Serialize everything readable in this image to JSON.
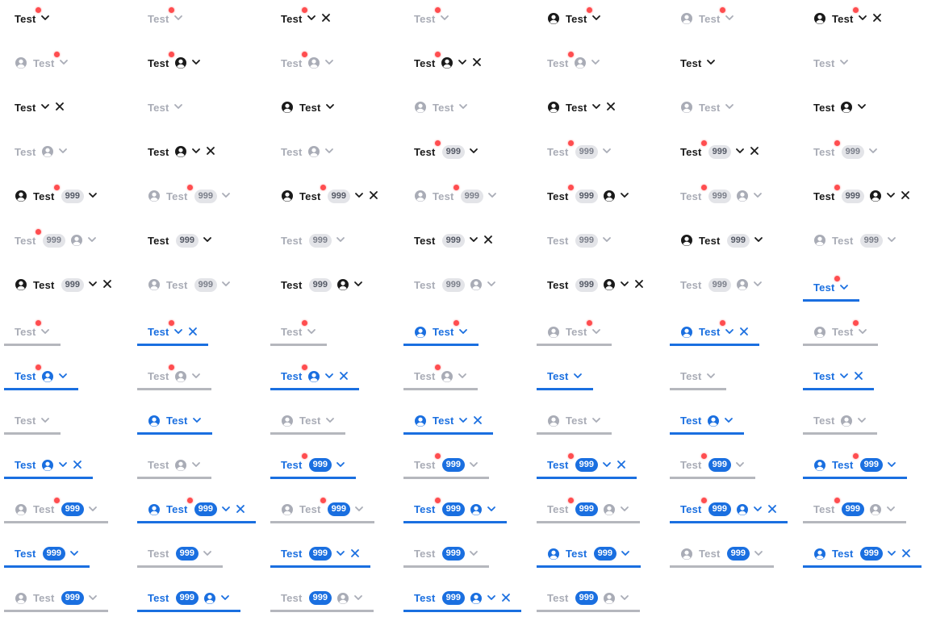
{
  "page": {
    "background": "#ffffff"
  },
  "colors": {
    "dark_text": "#1a1a1a",
    "muted_text": "#a9acb6",
    "accent_blue": "#1a6fe0",
    "notification_dot": "#ff4d4f",
    "underline_muted": "#b5b7bd",
    "badge_gray": "#e3e4e8"
  },
  "icons": {
    "avatar": "user-circle-icon",
    "chevron": "chevron-down-icon",
    "close": "close-icon",
    "dot": "notification-dot"
  },
  "tabs": [
    {
      "label": "Test",
      "theme": "dark",
      "dot": true,
      "lead_avatar": false,
      "badge": "",
      "trail_avatar": false,
      "close": false
    },
    {
      "label": "Test",
      "theme": "muted",
      "dot": true,
      "lead_avatar": false,
      "badge": "",
      "trail_avatar": false,
      "close": false
    },
    {
      "label": "Test",
      "theme": "dark",
      "dot": true,
      "lead_avatar": false,
      "badge": "",
      "trail_avatar": false,
      "close": true
    },
    {
      "label": "Test",
      "theme": "muted",
      "dot": true,
      "lead_avatar": false,
      "badge": "",
      "trail_avatar": false,
      "close": false
    },
    {
      "label": "Test",
      "theme": "dark",
      "dot": true,
      "lead_avatar": true,
      "badge": "",
      "trail_avatar": false,
      "close": false
    },
    {
      "label": "Test",
      "theme": "muted",
      "dot": true,
      "lead_avatar": true,
      "badge": "",
      "trail_avatar": false,
      "close": false
    },
    {
      "label": "Test",
      "theme": "dark",
      "dot": true,
      "lead_avatar": true,
      "badge": "",
      "trail_avatar": false,
      "close": true
    },
    {
      "label": "Test",
      "theme": "muted",
      "dot": true,
      "lead_avatar": true,
      "badge": "",
      "trail_avatar": false,
      "close": false
    },
    {
      "label": "Test",
      "theme": "dark",
      "dot": true,
      "lead_avatar": false,
      "badge": "",
      "trail_avatar": true,
      "close": false
    },
    {
      "label": "Test",
      "theme": "muted",
      "dot": true,
      "lead_avatar": false,
      "badge": "",
      "trail_avatar": true,
      "close": false
    },
    {
      "label": "Test",
      "theme": "dark",
      "dot": true,
      "lead_avatar": false,
      "badge": "",
      "trail_avatar": true,
      "close": true
    },
    {
      "label": "Test",
      "theme": "muted",
      "dot": true,
      "lead_avatar": false,
      "badge": "",
      "trail_avatar": true,
      "close": false
    },
    {
      "label": "Test",
      "theme": "dark",
      "dot": false,
      "lead_avatar": false,
      "badge": "",
      "trail_avatar": false,
      "close": false
    },
    {
      "label": "Test",
      "theme": "muted",
      "dot": false,
      "lead_avatar": false,
      "badge": "",
      "trail_avatar": false,
      "close": false
    },
    {
      "label": "Test",
      "theme": "dark",
      "dot": false,
      "lead_avatar": false,
      "badge": "",
      "trail_avatar": false,
      "close": true
    },
    {
      "label": "Test",
      "theme": "muted",
      "dot": false,
      "lead_avatar": false,
      "badge": "",
      "trail_avatar": false,
      "close": false
    },
    {
      "label": "Test",
      "theme": "dark",
      "dot": false,
      "lead_avatar": true,
      "badge": "",
      "trail_avatar": false,
      "close": false
    },
    {
      "label": "Test",
      "theme": "muted",
      "dot": false,
      "lead_avatar": true,
      "badge": "",
      "trail_avatar": false,
      "close": false
    },
    {
      "label": "Test",
      "theme": "dark",
      "dot": false,
      "lead_avatar": true,
      "badge": "",
      "trail_avatar": false,
      "close": true
    },
    {
      "label": "Test",
      "theme": "muted",
      "dot": false,
      "lead_avatar": true,
      "badge": "",
      "trail_avatar": false,
      "close": false
    },
    {
      "label": "Test",
      "theme": "dark",
      "dot": false,
      "lead_avatar": false,
      "badge": "",
      "trail_avatar": true,
      "close": false
    },
    {
      "label": "Test",
      "theme": "muted",
      "dot": false,
      "lead_avatar": false,
      "badge": "",
      "trail_avatar": true,
      "close": false
    },
    {
      "label": "Test",
      "theme": "dark",
      "dot": false,
      "lead_avatar": false,
      "badge": "",
      "trail_avatar": true,
      "close": true
    },
    {
      "label": "Test",
      "theme": "muted",
      "dot": false,
      "lead_avatar": false,
      "badge": "",
      "trail_avatar": true,
      "close": false
    },
    {
      "label": "Test",
      "theme": "dark",
      "dot": true,
      "lead_avatar": false,
      "badge": "999",
      "trail_avatar": false,
      "close": false
    },
    {
      "label": "Test",
      "theme": "muted",
      "dot": true,
      "lead_avatar": false,
      "badge": "999",
      "trail_avatar": false,
      "close": false
    },
    {
      "label": "Test",
      "theme": "dark",
      "dot": true,
      "lead_avatar": false,
      "badge": "999",
      "trail_avatar": false,
      "close": true
    },
    {
      "label": "Test",
      "theme": "muted",
      "dot": true,
      "lead_avatar": false,
      "badge": "999",
      "trail_avatar": false,
      "close": false
    },
    {
      "label": "Test",
      "theme": "dark",
      "dot": true,
      "lead_avatar": true,
      "badge": "999",
      "trail_avatar": false,
      "close": false
    },
    {
      "label": "Test",
      "theme": "muted",
      "dot": true,
      "lead_avatar": true,
      "badge": "999",
      "trail_avatar": false,
      "close": false
    },
    {
      "label": "Test",
      "theme": "dark",
      "dot": true,
      "lead_avatar": true,
      "badge": "999",
      "trail_avatar": false,
      "close": true
    },
    {
      "label": "Test",
      "theme": "muted",
      "dot": true,
      "lead_avatar": true,
      "badge": "999",
      "trail_avatar": false,
      "close": false
    },
    {
      "label": "Test",
      "theme": "dark",
      "dot": true,
      "lead_avatar": false,
      "badge": "999",
      "trail_avatar": true,
      "close": false
    },
    {
      "label": "Test",
      "theme": "muted",
      "dot": true,
      "lead_avatar": false,
      "badge": "999",
      "trail_avatar": true,
      "close": false
    },
    {
      "label": "Test",
      "theme": "dark",
      "dot": true,
      "lead_avatar": false,
      "badge": "999",
      "trail_avatar": true,
      "close": true
    },
    {
      "label": "Test",
      "theme": "muted",
      "dot": true,
      "lead_avatar": false,
      "badge": "999",
      "trail_avatar": true,
      "close": false
    },
    {
      "label": "Test",
      "theme": "dark",
      "dot": false,
      "lead_avatar": false,
      "badge": "999",
      "trail_avatar": false,
      "close": false
    },
    {
      "label": "Test",
      "theme": "muted",
      "dot": false,
      "lead_avatar": false,
      "badge": "999",
      "trail_avatar": false,
      "close": false
    },
    {
      "label": "Test",
      "theme": "dark",
      "dot": false,
      "lead_avatar": false,
      "badge": "999",
      "trail_avatar": false,
      "close": true
    },
    {
      "label": "Test",
      "theme": "muted",
      "dot": false,
      "lead_avatar": false,
      "badge": "999",
      "trail_avatar": false,
      "close": false
    },
    {
      "label": "Test",
      "theme": "dark",
      "dot": false,
      "lead_avatar": true,
      "badge": "999",
      "trail_avatar": false,
      "close": false
    },
    {
      "label": "Test",
      "theme": "muted",
      "dot": false,
      "lead_avatar": true,
      "badge": "999",
      "trail_avatar": false,
      "close": false
    },
    {
      "label": "Test",
      "theme": "dark",
      "dot": false,
      "lead_avatar": true,
      "badge": "999",
      "trail_avatar": false,
      "close": true
    },
    {
      "label": "Test",
      "theme": "muted",
      "dot": false,
      "lead_avatar": true,
      "badge": "999",
      "trail_avatar": false,
      "close": false
    },
    {
      "label": "Test",
      "theme": "dark",
      "dot": false,
      "lead_avatar": false,
      "badge": "999",
      "trail_avatar": true,
      "close": false
    },
    {
      "label": "Test",
      "theme": "muted",
      "dot": false,
      "lead_avatar": false,
      "badge": "999",
      "trail_avatar": true,
      "close": false
    },
    {
      "label": "Test",
      "theme": "dark",
      "dot": false,
      "lead_avatar": false,
      "badge": "999",
      "trail_avatar": true,
      "close": true
    },
    {
      "label": "Test",
      "theme": "muted",
      "dot": false,
      "lead_avatar": false,
      "badge": "999",
      "trail_avatar": true,
      "close": false
    },
    {
      "label": "Test",
      "theme": "blue",
      "dot": true,
      "lead_avatar": false,
      "badge": "",
      "trail_avatar": false,
      "close": false
    },
    {
      "label": "Test",
      "theme": "mline",
      "dot": true,
      "lead_avatar": false,
      "badge": "",
      "trail_avatar": false,
      "close": false
    },
    {
      "label": "Test",
      "theme": "blue",
      "dot": true,
      "lead_avatar": false,
      "badge": "",
      "trail_avatar": false,
      "close": true
    },
    {
      "label": "Test",
      "theme": "mline",
      "dot": true,
      "lead_avatar": false,
      "badge": "",
      "trail_avatar": false,
      "close": false
    },
    {
      "label": "Test",
      "theme": "blue",
      "dot": true,
      "lead_avatar": true,
      "badge": "",
      "trail_avatar": false,
      "close": false
    },
    {
      "label": "Test",
      "theme": "mline",
      "dot": true,
      "lead_avatar": true,
      "badge": "",
      "trail_avatar": false,
      "close": false
    },
    {
      "label": "Test",
      "theme": "blue",
      "dot": true,
      "lead_avatar": true,
      "badge": "",
      "trail_avatar": false,
      "close": true
    },
    {
      "label": "Test",
      "theme": "mline",
      "dot": true,
      "lead_avatar": true,
      "badge": "",
      "trail_avatar": false,
      "close": false
    },
    {
      "label": "Test",
      "theme": "blue",
      "dot": true,
      "lead_avatar": false,
      "badge": "",
      "trail_avatar": true,
      "close": false
    },
    {
      "label": "Test",
      "theme": "mline",
      "dot": true,
      "lead_avatar": false,
      "badge": "",
      "trail_avatar": true,
      "close": false
    },
    {
      "label": "Test",
      "theme": "blue",
      "dot": true,
      "lead_avatar": false,
      "badge": "",
      "trail_avatar": true,
      "close": true
    },
    {
      "label": "Test",
      "theme": "mline",
      "dot": true,
      "lead_avatar": false,
      "badge": "",
      "trail_avatar": true,
      "close": false
    },
    {
      "label": "Test",
      "theme": "blue",
      "dot": false,
      "lead_avatar": false,
      "badge": "",
      "trail_avatar": false,
      "close": false
    },
    {
      "label": "Test",
      "theme": "mline",
      "dot": false,
      "lead_avatar": false,
      "badge": "",
      "trail_avatar": false,
      "close": false
    },
    {
      "label": "Test",
      "theme": "blue",
      "dot": false,
      "lead_avatar": false,
      "badge": "",
      "trail_avatar": false,
      "close": true
    },
    {
      "label": "Test",
      "theme": "mline",
      "dot": false,
      "lead_avatar": false,
      "badge": "",
      "trail_avatar": false,
      "close": false
    },
    {
      "label": "Test",
      "theme": "blue",
      "dot": false,
      "lead_avatar": true,
      "badge": "",
      "trail_avatar": false,
      "close": false
    },
    {
      "label": "Test",
      "theme": "mline",
      "dot": false,
      "lead_avatar": true,
      "badge": "",
      "trail_avatar": false,
      "close": false
    },
    {
      "label": "Test",
      "theme": "blue",
      "dot": false,
      "lead_avatar": true,
      "badge": "",
      "trail_avatar": false,
      "close": true
    },
    {
      "label": "Test",
      "theme": "mline",
      "dot": false,
      "lead_avatar": true,
      "badge": "",
      "trail_avatar": false,
      "close": false
    },
    {
      "label": "Test",
      "theme": "blue",
      "dot": false,
      "lead_avatar": false,
      "badge": "",
      "trail_avatar": true,
      "close": false
    },
    {
      "label": "Test",
      "theme": "mline",
      "dot": false,
      "lead_avatar": false,
      "badge": "",
      "trail_avatar": true,
      "close": false
    },
    {
      "label": "Test",
      "theme": "blue",
      "dot": false,
      "lead_avatar": false,
      "badge": "",
      "trail_avatar": true,
      "close": true
    },
    {
      "label": "Test",
      "theme": "mline",
      "dot": false,
      "lead_avatar": false,
      "badge": "",
      "trail_avatar": true,
      "close": false
    },
    {
      "label": "Test",
      "theme": "blue",
      "dot": true,
      "lead_avatar": false,
      "badge": "999",
      "trail_avatar": false,
      "close": false
    },
    {
      "label": "Test",
      "theme": "mline",
      "dot": true,
      "lead_avatar": false,
      "badge": "999",
      "trail_avatar": false,
      "close": false
    },
    {
      "label": "Test",
      "theme": "blue",
      "dot": true,
      "lead_avatar": false,
      "badge": "999",
      "trail_avatar": false,
      "close": true
    },
    {
      "label": "Test",
      "theme": "mline",
      "dot": true,
      "lead_avatar": false,
      "badge": "999",
      "trail_avatar": false,
      "close": false
    },
    {
      "label": "Test",
      "theme": "blue",
      "dot": true,
      "lead_avatar": true,
      "badge": "999",
      "trail_avatar": false,
      "close": false
    },
    {
      "label": "Test",
      "theme": "mline",
      "dot": true,
      "lead_avatar": true,
      "badge": "999",
      "trail_avatar": false,
      "close": false
    },
    {
      "label": "Test",
      "theme": "blue",
      "dot": true,
      "lead_avatar": true,
      "badge": "999",
      "trail_avatar": false,
      "close": true
    },
    {
      "label": "Test",
      "theme": "mline",
      "dot": true,
      "lead_avatar": true,
      "badge": "999",
      "trail_avatar": false,
      "close": false
    },
    {
      "label": "Test",
      "theme": "blue",
      "dot": true,
      "lead_avatar": false,
      "badge": "999",
      "trail_avatar": true,
      "close": false
    },
    {
      "label": "Test",
      "theme": "mline",
      "dot": true,
      "lead_avatar": false,
      "badge": "999",
      "trail_avatar": true,
      "close": false
    },
    {
      "label": "Test",
      "theme": "blue",
      "dot": true,
      "lead_avatar": false,
      "badge": "999",
      "trail_avatar": true,
      "close": true
    },
    {
      "label": "Test",
      "theme": "mline",
      "dot": true,
      "lead_avatar": false,
      "badge": "999",
      "trail_avatar": true,
      "close": false
    },
    {
      "label": "Test",
      "theme": "blue",
      "dot": false,
      "lead_avatar": false,
      "badge": "999",
      "trail_avatar": false,
      "close": false
    },
    {
      "label": "Test",
      "theme": "mline",
      "dot": false,
      "lead_avatar": false,
      "badge": "999",
      "trail_avatar": false,
      "close": false
    },
    {
      "label": "Test",
      "theme": "blue",
      "dot": false,
      "lead_avatar": false,
      "badge": "999",
      "trail_avatar": false,
      "close": true
    },
    {
      "label": "Test",
      "theme": "mline",
      "dot": false,
      "lead_avatar": false,
      "badge": "999",
      "trail_avatar": false,
      "close": false
    },
    {
      "label": "Test",
      "theme": "blue",
      "dot": false,
      "lead_avatar": true,
      "badge": "999",
      "trail_avatar": false,
      "close": false
    },
    {
      "label": "Test",
      "theme": "mline",
      "dot": false,
      "lead_avatar": true,
      "badge": "999",
      "trail_avatar": false,
      "close": false
    },
    {
      "label": "Test",
      "theme": "blue",
      "dot": false,
      "lead_avatar": true,
      "badge": "999",
      "trail_avatar": false,
      "close": true
    },
    {
      "label": "Test",
      "theme": "mline",
      "dot": false,
      "lead_avatar": true,
      "badge": "999",
      "trail_avatar": false,
      "close": false
    },
    {
      "label": "Test",
      "theme": "blue",
      "dot": false,
      "lead_avatar": false,
      "badge": "999",
      "trail_avatar": true,
      "close": false
    },
    {
      "label": "Test",
      "theme": "mline",
      "dot": false,
      "lead_avatar": false,
      "badge": "999",
      "trail_avatar": true,
      "close": false
    },
    {
      "label": "Test",
      "theme": "blue",
      "dot": false,
      "lead_avatar": false,
      "badge": "999",
      "trail_avatar": true,
      "close": true
    },
    {
      "label": "Test",
      "theme": "mline",
      "dot": false,
      "lead_avatar": false,
      "badge": "999",
      "trail_avatar": true,
      "close": false
    }
  ]
}
